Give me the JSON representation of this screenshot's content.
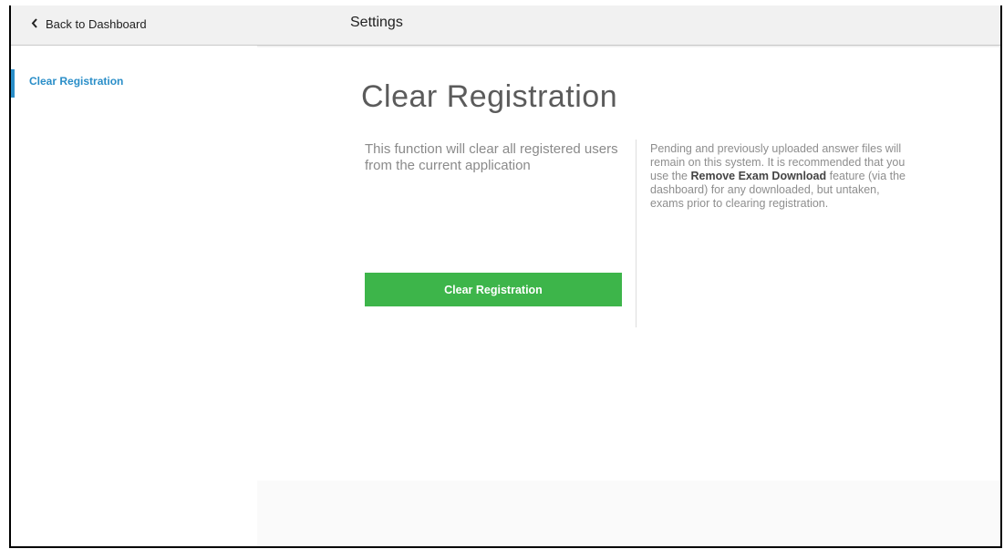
{
  "header": {
    "back_label": "Back to Dashboard",
    "title": "Settings",
    "icons": {
      "back": "chevron-left-icon"
    }
  },
  "sidebar": {
    "items": [
      {
        "label": "Clear Registration",
        "active": true
      }
    ],
    "accent_color": "#2a8ec8"
  },
  "main": {
    "title": "Clear Registration",
    "description": "This function will clear all registered users from the current application",
    "note": {
      "part1": "Pending and previously uploaded answer files will remain on this system. It is recommended that you use the ",
      "bold": "Remove Exam Download",
      "part2": " feature (via the dashboard) for any downloaded, but untaken, exams prior to clearing registration."
    },
    "button_label": "Clear Registration",
    "button_color": "#3db54a"
  }
}
